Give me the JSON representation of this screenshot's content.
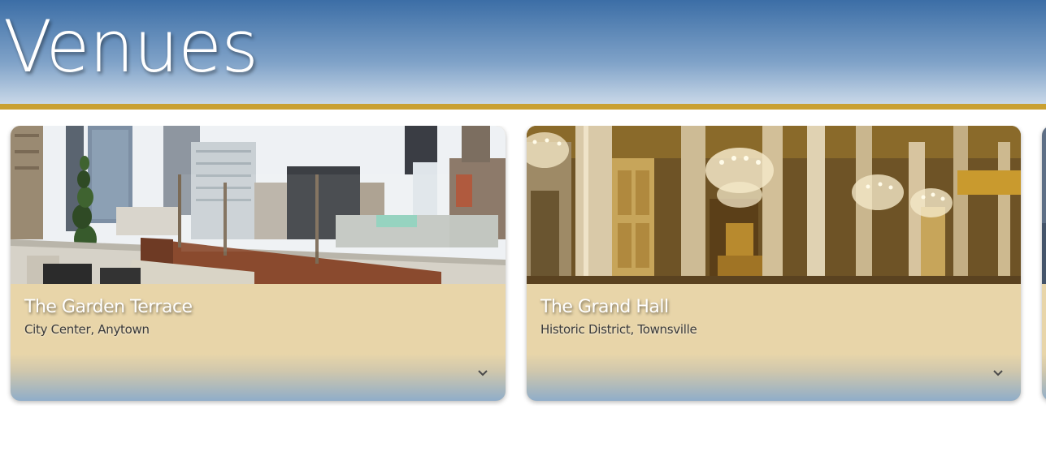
{
  "header": {
    "title": "Venues"
  },
  "theme": {
    "header_gradient_top": "#3c6ea6",
    "accent_rule": "#c9a032",
    "card_body": "#e8d5a9"
  },
  "venues": [
    {
      "name": "The Garden Terrace",
      "location": "City Center, Anytown",
      "image_alt": "rooftop terrace with city skyline",
      "expand_icon": "chevron-down-icon"
    },
    {
      "name": "The Grand Hall",
      "location": "Historic District, Townsville",
      "image_alt": "ornate gilded ballroom with chandeliers",
      "expand_icon": "chevron-down-icon"
    },
    {
      "name": "",
      "location": "",
      "image_alt": "partially visible venue card",
      "expand_icon": "chevron-down-icon"
    }
  ]
}
